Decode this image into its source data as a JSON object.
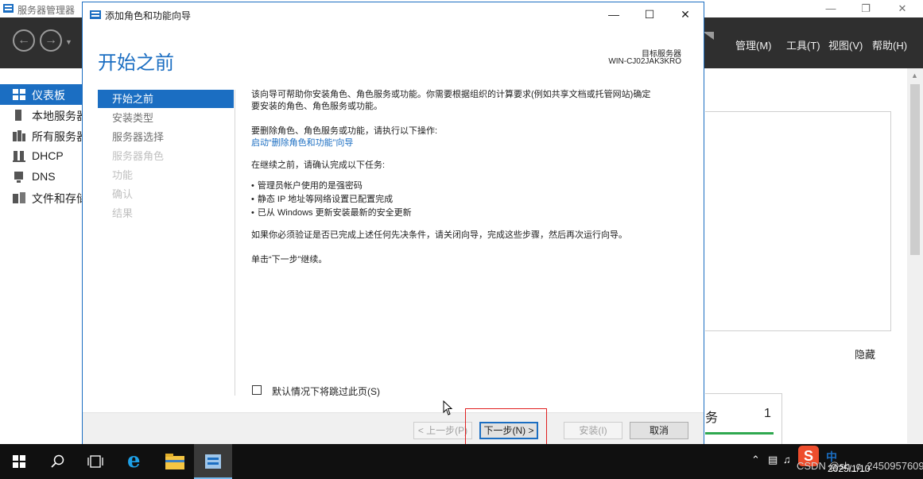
{
  "server_manager": {
    "title": "服务器管理器",
    "menu": [
      {
        "label": "管理(M)"
      },
      {
        "label": "工具(T)"
      },
      {
        "label": "视图(V)"
      },
      {
        "label": "帮助(H)"
      }
    ],
    "sidebar": [
      {
        "label": "仪表板",
        "icon": "dashboard-icon",
        "active": true
      },
      {
        "label": "本地服务器",
        "icon": "server-icon",
        "active": false
      },
      {
        "label": "所有服务器",
        "icon": "servers-icon",
        "active": false
      },
      {
        "label": "DHCP",
        "icon": "dhcp-icon",
        "active": false
      },
      {
        "label": "DNS",
        "icon": "dns-icon",
        "active": false
      },
      {
        "label": "文件和存储服务",
        "icon": "file-storage-icon",
        "active": false
      }
    ],
    "hide_link": "隐藏",
    "tile": {
      "label": "务",
      "count": "1"
    }
  },
  "wizard": {
    "title": "添加角色和功能向导",
    "heading": "开始之前",
    "target_label": "目标服务器",
    "target_name": "WIN-CJ02JAK3KRO",
    "steps": [
      {
        "label": "开始之前",
        "state": "current"
      },
      {
        "label": "安装类型",
        "state": "enabled"
      },
      {
        "label": "服务器选择",
        "state": "enabled"
      },
      {
        "label": "服务器角色",
        "state": "disabled"
      },
      {
        "label": "功能",
        "state": "disabled"
      },
      {
        "label": "确认",
        "state": "disabled"
      },
      {
        "label": "结果",
        "state": "disabled"
      }
    ],
    "body": {
      "intro_line1": "该向导可帮助你安装角色、角色服务或功能。你需要根据组织的计算要求(例如共享文档或托管网站)确定",
      "intro_line2": "要安装的角色、角色服务或功能。",
      "remove_text": "要删除角色、角色服务或功能，请执行以下操作:",
      "remove_link": "启动“删除角色和功能”向导",
      "before_text": "在继续之前，请确认完成以下任务:",
      "tasks": [
        "管理员帐户使用的是强密码",
        "静态 IP 地址等网络设置已配置完成",
        "已从 Windows 更新安装最新的安全更新"
      ],
      "verify_text": "如果你必须验证是否已完成上述任何先决条件，请关闭向导，完成这些步骤，然后再次运行向导。",
      "continue_text": "单击“下一步”继续。"
    },
    "skip_checkbox": {
      "label": "默认情况下将跳过此页(S)",
      "checked": false
    },
    "buttons": {
      "previous": "< 上一步(P)",
      "next": "下一步(N) >",
      "install": "安装(I)",
      "cancel": "取消"
    }
  },
  "taskbar": {
    "ime_label": "中",
    "watermark": "CSDN @sh_c_2450957609",
    "clock": "2025/1/10"
  },
  "colors": {
    "accent": "#1b6ec2",
    "header_bg": "#2f2f2f",
    "highlight": "#e02020",
    "taskbar": "#101010"
  }
}
